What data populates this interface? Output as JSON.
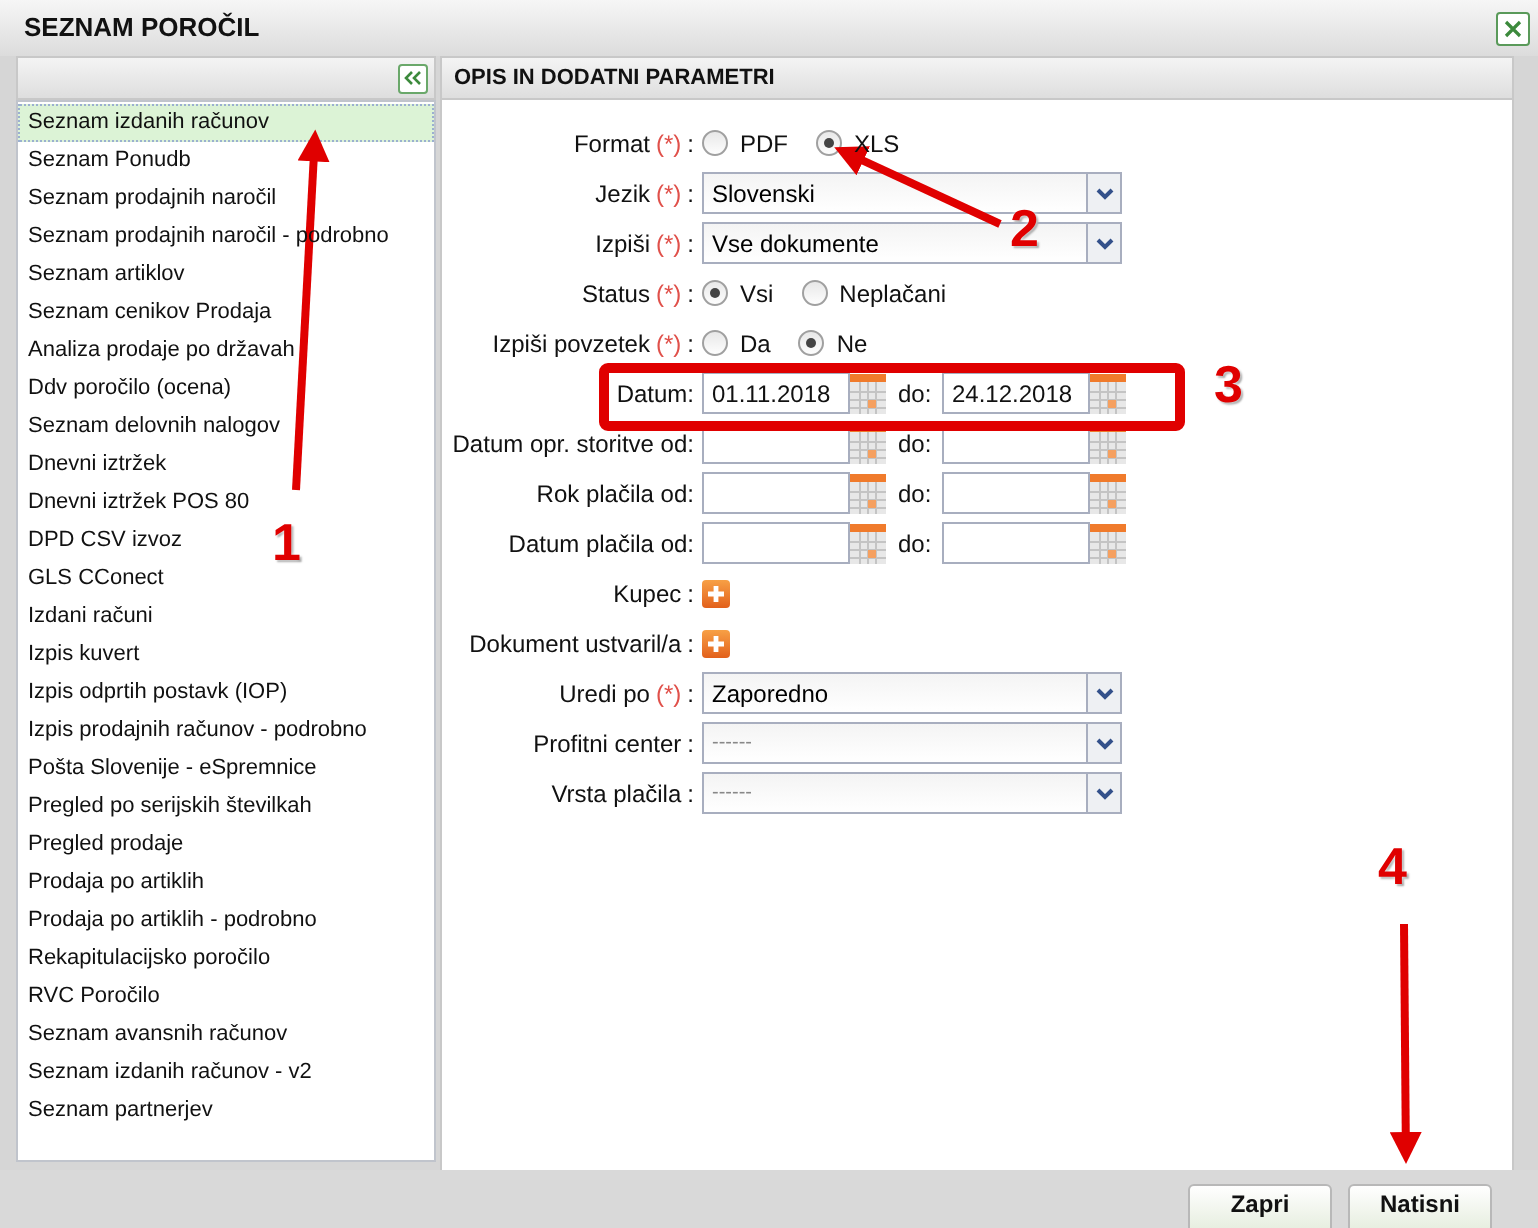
{
  "window": {
    "title": "SEZNAM POROČIL"
  },
  "sidebar": {
    "items": [
      {
        "label": "Seznam izdanih računov",
        "selected": true
      },
      {
        "label": "Seznam Ponudb",
        "selected": false
      },
      {
        "label": "Seznam prodajnih naročil",
        "selected": false
      },
      {
        "label": "Seznam prodajnih naročil - podrobno",
        "selected": false
      },
      {
        "label": "Seznam artiklov",
        "selected": false
      },
      {
        "label": "Seznam cenikov Prodaja",
        "selected": false
      },
      {
        "label": "Analiza prodaje po državah",
        "selected": false
      },
      {
        "label": "Ddv poročilo (ocena)",
        "selected": false
      },
      {
        "label": "Seznam delovnih nalogov",
        "selected": false
      },
      {
        "label": "Dnevni iztržek",
        "selected": false
      },
      {
        "label": "Dnevni iztržek POS 80",
        "selected": false
      },
      {
        "label": "DPD CSV izvoz",
        "selected": false
      },
      {
        "label": "GLS CConect",
        "selected": false
      },
      {
        "label": "Izdani računi",
        "selected": false
      },
      {
        "label": "Izpis kuvert",
        "selected": false
      },
      {
        "label": "Izpis odprtih postavk (IOP)",
        "selected": false
      },
      {
        "label": "Izpis prodajnih računov - podrobno",
        "selected": false
      },
      {
        "label": "Pošta Slovenije - eSpremnice",
        "selected": false
      },
      {
        "label": "Pregled po serijskih številkah",
        "selected": false
      },
      {
        "label": "Pregled prodaje",
        "selected": false
      },
      {
        "label": "Prodaja po artiklih",
        "selected": false
      },
      {
        "label": "Prodaja po artiklih - podrobno",
        "selected": false
      },
      {
        "label": "Rekapitulacijsko poročilo",
        "selected": false
      },
      {
        "label": "RVC Poročilo",
        "selected": false
      },
      {
        "label": "Seznam avansnih računov",
        "selected": false
      },
      {
        "label": "Seznam izdanih računov - v2",
        "selected": false
      },
      {
        "label": "Seznam partnerjev",
        "selected": false
      }
    ]
  },
  "panel": {
    "title": "OPIS IN DODATNI PARAMETRI",
    "rows": [
      {
        "kind": "radio",
        "label": "Format",
        "required": "(*)",
        "suffix": ":",
        "options": [
          {
            "label": "PDF",
            "selected": false
          },
          {
            "label": "XLS",
            "selected": true
          }
        ]
      },
      {
        "kind": "select",
        "label": "Jezik",
        "required": "(*)",
        "suffix": ":",
        "value": "Slovenski"
      },
      {
        "kind": "select",
        "label": "Izpiši",
        "required": "(*)",
        "suffix": ":",
        "value": "Vse dokumente"
      },
      {
        "kind": "radio",
        "label": "Status",
        "required": "(*)",
        "suffix": ":",
        "options": [
          {
            "label": "Vsi",
            "selected": true
          },
          {
            "label": "Neplačani",
            "selected": false
          }
        ]
      },
      {
        "kind": "radio",
        "label": "Izpiši povzetek",
        "required": "(*)",
        "suffix": ":",
        "options": [
          {
            "label": "Da",
            "selected": false
          },
          {
            "label": "Ne",
            "selected": true
          }
        ]
      },
      {
        "kind": "daterange",
        "label": "Datum:",
        "from": "01.11.2018",
        "to_label": "do:",
        "to": "24.12.2018"
      },
      {
        "kind": "daterange",
        "label": "Datum opr. storitve od:",
        "to_label": "do:"
      },
      {
        "kind": "daterange",
        "label": "Rok plačila od:",
        "to_label": "do:"
      },
      {
        "kind": "daterange",
        "label": "Datum plačila od:",
        "to_label": "do:"
      },
      {
        "kind": "add",
        "label": "Kupec",
        "suffix": ":"
      },
      {
        "kind": "add",
        "label": "Dokument ustvaril/a",
        "suffix": ":"
      },
      {
        "kind": "select",
        "label": "Uredi po",
        "required": "(*)",
        "suffix": ":",
        "value": "Zaporedno"
      },
      {
        "kind": "select",
        "label": "Profitni center",
        "suffix": ":",
        "placeholder": "------"
      },
      {
        "kind": "select",
        "label": "Vrsta plačila",
        "suffix": ":",
        "placeholder": "------"
      }
    ]
  },
  "buttons": [
    "Zapri",
    "Natisni"
  ],
  "annotations": [
    {
      "kind": "arrow"
    },
    {
      "kind": "number",
      "text": "1"
    },
    {
      "kind": "arrow"
    },
    {
      "kind": "number",
      "text": "2"
    },
    {
      "kind": "frame"
    },
    {
      "kind": "number",
      "text": "3"
    },
    {
      "kind": "number",
      "text": "4"
    },
    {
      "kind": "arrow"
    }
  ]
}
